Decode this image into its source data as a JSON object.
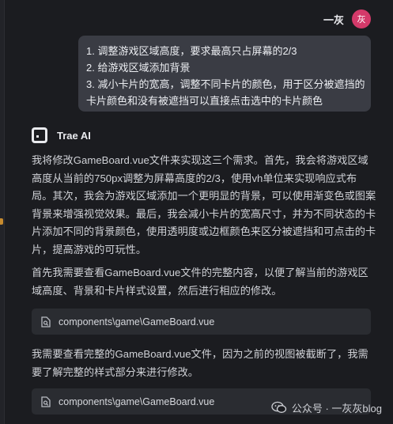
{
  "user": {
    "name": "一灰",
    "avatar_text": "灰"
  },
  "user_message": {
    "lines": [
      "1. 调整游戏区域高度，要求最高只占屏幕的2/3",
      "2. 给游戏区域添加背景",
      "3. 减小卡片的宽高，调整不同卡片的颜色，用于区分被遮挡的",
      "卡片颜色和没有被遮挡可以直接点击选中的卡片颜色"
    ]
  },
  "assistant": {
    "name": "Trae AI",
    "paragraph1": [
      "我将修改GameBoard.vue文件来实现这三个需求。首先，我会将游戏区域",
      "高度从当前的750px调整为屏幕高度的2/3，使用vh单位来实现响应式布",
      "局。其次，我会为游戏区域添加一个更明显的背景，可以使用渐变色或图案",
      "背景来增强视觉效果。最后，我会减小卡片的宽高尺寸，并为不同状态的卡",
      "片添加不同的背景颜色，使用透明度或边框颜色来区分被遮挡和可点击的卡",
      "片，提高游戏的可玩性。"
    ],
    "paragraph2": [
      "首先我需要查看GameBoard.vue文件的完整内容，以便了解当前的游戏区",
      "域高度、背景和卡片样式设置，然后进行相应的修改。"
    ],
    "file_ref_1": "components\\game\\GameBoard.vue",
    "paragraph3": [
      "我需要查看完整的GameBoard.vue文件，因为之前的视图被截断了，我需",
      "要了解完整的样式部分来进行修改。"
    ],
    "file_ref_2": "components\\game\\GameBoard.vue"
  },
  "watermark": {
    "text": "公众号 · 一灰灰blog",
    "icon": "wechat-icon"
  },
  "colors": {
    "background": "#1b1c20",
    "bubble": "#3a3c44",
    "file_chip": "#2a2c31",
    "avatar": "#d43a6a",
    "accent_marker": "#c68a2e"
  }
}
